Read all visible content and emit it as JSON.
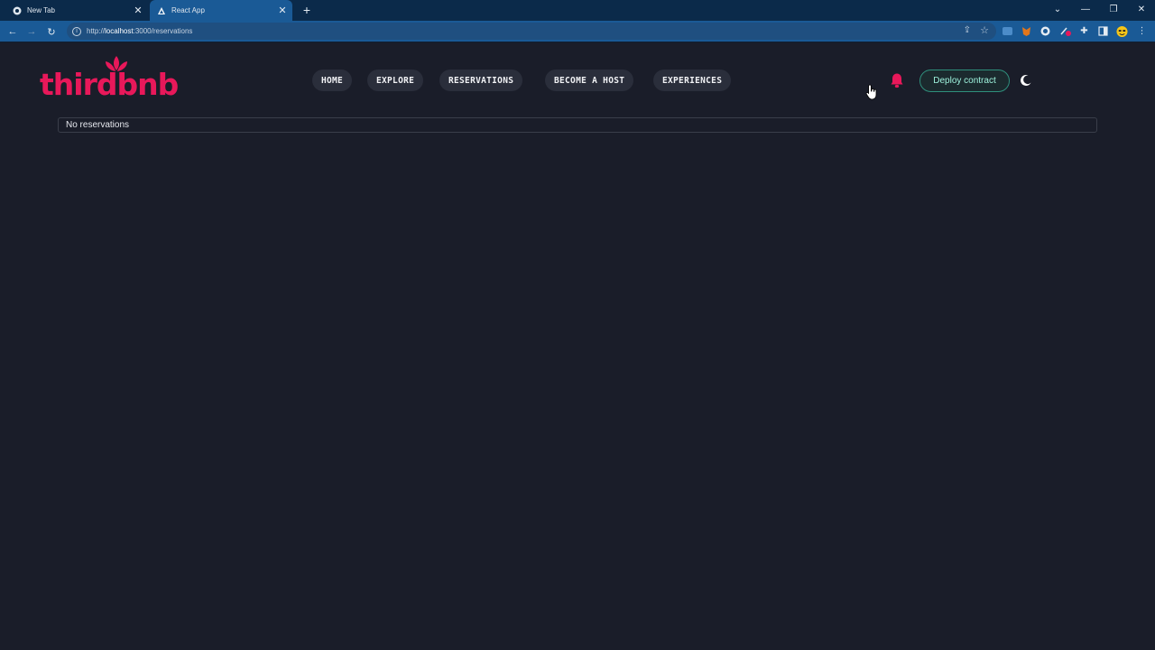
{
  "browser": {
    "tabs": [
      {
        "title": "New Tab",
        "icon": "chrome-icon"
      },
      {
        "title": "React App",
        "icon": "react-icon"
      }
    ],
    "url_prefix": "http://",
    "url_host": "localhost",
    "url_path": ":3000/reservations"
  },
  "app": {
    "logo_text": "thirdbnb",
    "nav": [
      "HOME",
      "EXPLORE",
      "RESERVATIONS",
      "BECOME A HOST",
      "EXPERIENCES"
    ],
    "deploy_label": "Deploy contract",
    "empty_message": "No reservations"
  },
  "colors": {
    "brand": "#e8185a",
    "background": "#1a1d29",
    "nav_pill": "#2a2e3b",
    "deploy_text": "#9ef3dd"
  }
}
